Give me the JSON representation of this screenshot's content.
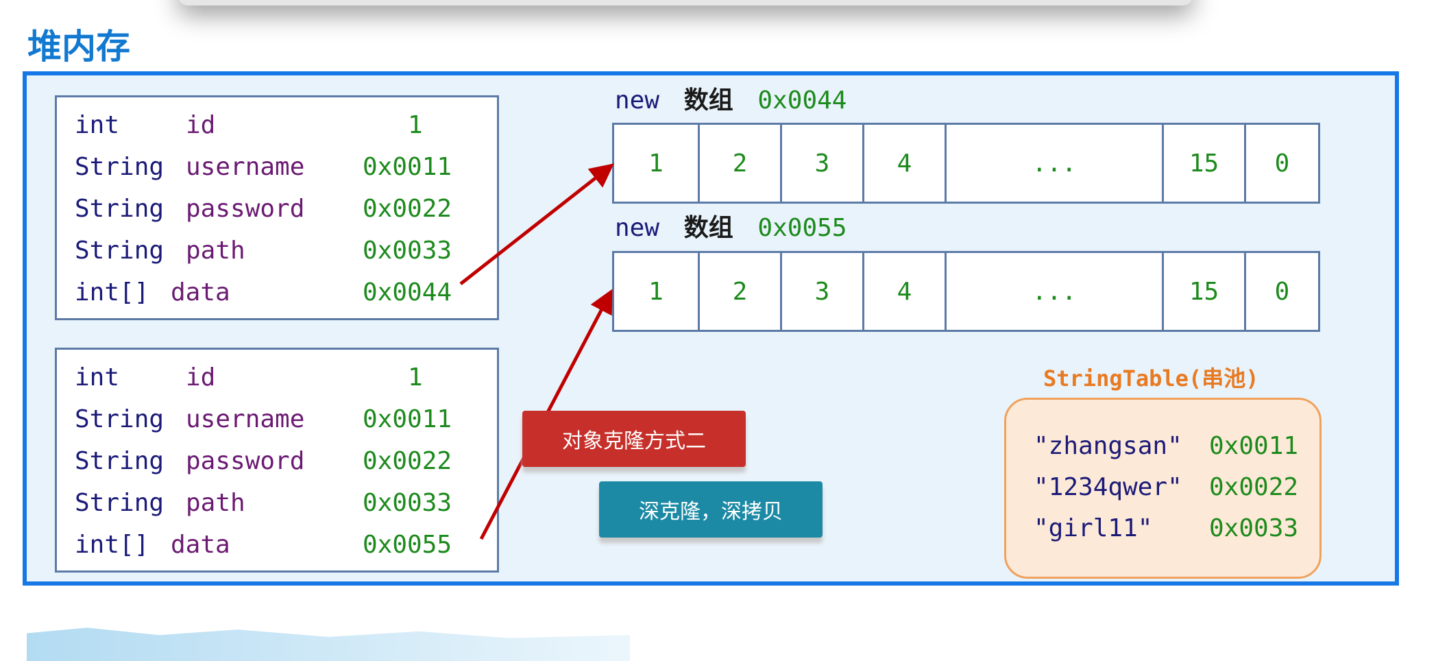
{
  "title": "堆内存",
  "objects": [
    {
      "fields": [
        {
          "type": "int",
          "name": "id",
          "value": "1"
        },
        {
          "type": "String",
          "name": "username",
          "value": "0x0011"
        },
        {
          "type": "String",
          "name": "password",
          "value": "0x0022"
        },
        {
          "type": "String",
          "name": "path",
          "value": "0x0033"
        },
        {
          "type": "int[]",
          "name": "data",
          "value": "0x0044"
        }
      ]
    },
    {
      "fields": [
        {
          "type": "int",
          "name": "id",
          "value": "1"
        },
        {
          "type": "String",
          "name": "username",
          "value": "0x0011"
        },
        {
          "type": "String",
          "name": "password",
          "value": "0x0022"
        },
        {
          "type": "String",
          "name": "path",
          "value": "0x0033"
        },
        {
          "type": "int[]",
          "name": "data",
          "value": "0x0055"
        }
      ]
    }
  ],
  "arrays": [
    {
      "keyword": "new",
      "label": "数组",
      "address": "0x0044",
      "cells": [
        "1",
        "2",
        "3",
        "4",
        "...",
        "15",
        "0"
      ]
    },
    {
      "keyword": "new",
      "label": "数组",
      "address": "0x0055",
      "cells": [
        "1",
        "2",
        "3",
        "4",
        "...",
        "15",
        "0"
      ]
    }
  ],
  "buttons": {
    "clone_method": "对象克隆方式二",
    "deep_clone": "深克隆，深拷贝"
  },
  "string_table": {
    "title": "StringTable(串池)",
    "entries": [
      {
        "literal": "\"zhangsan\"",
        "address": "0x0011"
      },
      {
        "literal": "\"1234qwer\"",
        "address": "0x0022"
      },
      {
        "literal": "\"girl11\"",
        "address": "0x0033"
      }
    ]
  },
  "colors": {
    "panel_border": "#1677e6",
    "panel_bg": "#e9f3fb",
    "type_text": "#1a1a78",
    "name_text": "#6b1a72",
    "value_text": "#1c8a1c",
    "arrow": "#c00000",
    "button_red": "#c7302a",
    "button_teal": "#1c8aa5",
    "string_table_title": "#e87a22"
  }
}
